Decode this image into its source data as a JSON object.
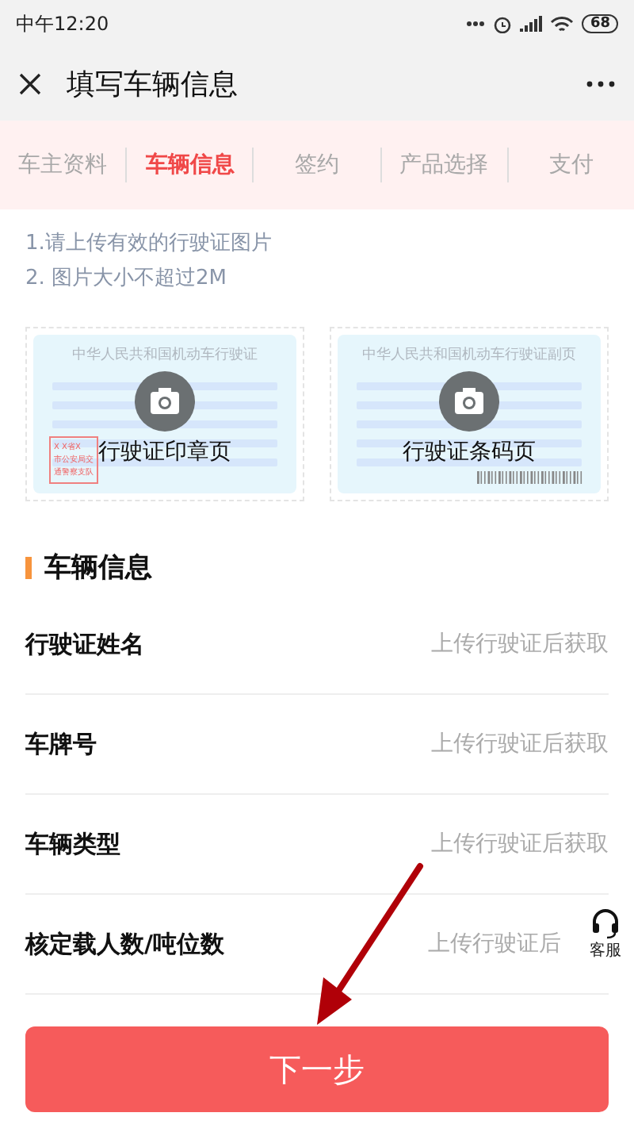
{
  "status_bar": {
    "time": "中午12:20",
    "battery": "68"
  },
  "nav": {
    "title": "填写车辆信息"
  },
  "steps": [
    {
      "label": "车主资料",
      "selected": false
    },
    {
      "label": "车辆信息",
      "selected": true
    },
    {
      "label": "签约",
      "selected": false
    },
    {
      "label": "产品选择",
      "selected": false
    },
    {
      "label": "支付",
      "selected": false
    }
  ],
  "notes": [
    "1.请上传有效的行驶证图片",
    "2. 图片大小不超过2M"
  ],
  "uploads": [
    {
      "kind": "stamp",
      "card_title": "中华人民共和国机动车行驶证",
      "label": "行驶证印章页",
      "stamp_lines": [
        "X  X省X",
        "市公安局交",
        "通警察支队"
      ]
    },
    {
      "kind": "barcode",
      "card_title": "中华人民共和国机动车行驶证副页",
      "label": "行驶证条码页"
    }
  ],
  "section": {
    "title": "车辆信息"
  },
  "fields": [
    {
      "label": "行驶证姓名",
      "placeholder": "上传行驶证后获取"
    },
    {
      "label": "车牌号",
      "placeholder": "上传行驶证后获取"
    },
    {
      "label": "车辆类型",
      "placeholder": "上传行驶证后获取"
    },
    {
      "label": "核定载人数/吨位数",
      "placeholder": "上传行驶证后"
    }
  ],
  "support": {
    "label": "客服"
  },
  "next_button": {
    "label": "下一步"
  }
}
